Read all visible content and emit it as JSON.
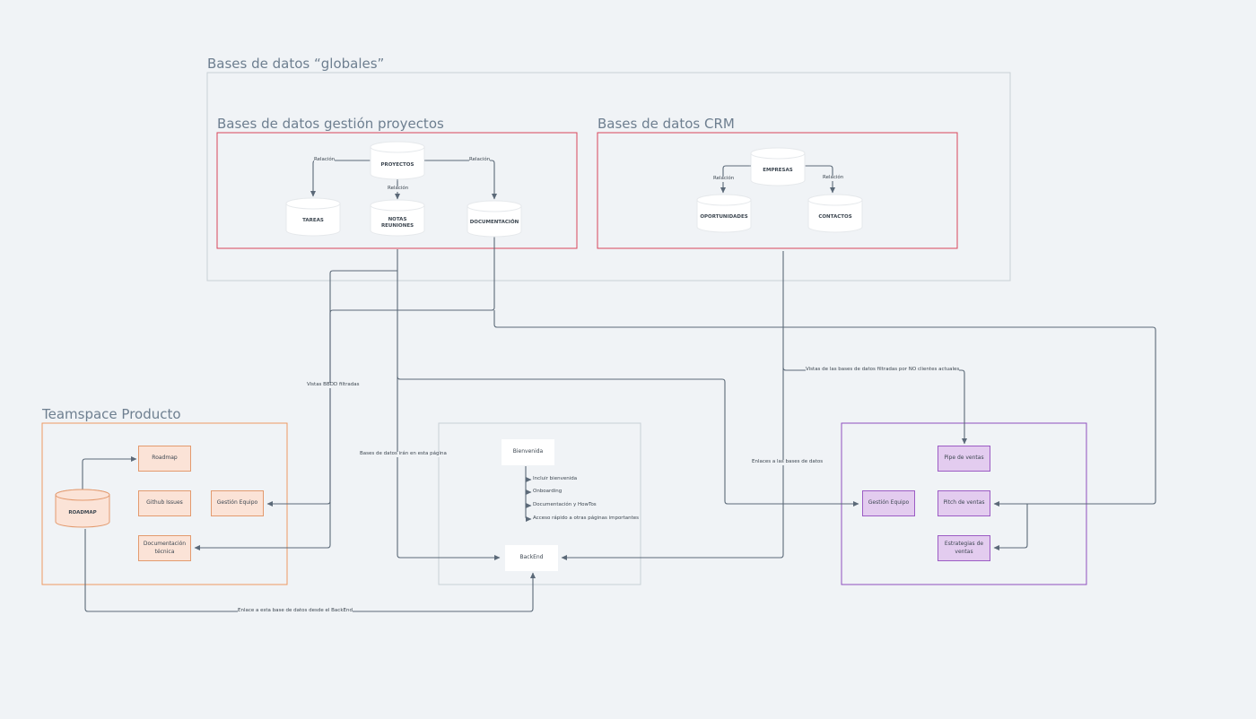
{
  "colors": {
    "background": "#f0f3f6",
    "connector": "#5b6978",
    "frame_global": "#c9d0d6",
    "frame_red": "#d9465a",
    "frame_orange": "#ee9a62",
    "frame_purple": "#8e4fbf",
    "frame_gray": "#c9d0d6"
  },
  "frames": {
    "global": {
      "title": "Bases de datos “globales”"
    },
    "projects": {
      "title": "Bases de datos gestión proyectos"
    },
    "crm": {
      "title": "Bases de datos CRM"
    },
    "producto": {
      "title": "Teamspace Producto"
    }
  },
  "databases": {
    "proyectos": "PROYECTOS",
    "tareas": "TAREAS",
    "notas": "NOTAS REUNIONES",
    "documentacion": "DOCUMENTACIÓN",
    "empresas": "EMPRESAS",
    "oportunidades": "OPORTUNIDADES",
    "contactos": "CONTACTOS",
    "roadmap": "ROADMAP"
  },
  "relations": {
    "proy_tareas": "Relación",
    "proy_notas": "Relación",
    "proy_doc": "Relación",
    "emp_oport": "Relación",
    "emp_contactos": "Relación"
  },
  "producto": {
    "roadmap": "Roadmap",
    "github": "Github Issues",
    "gestion": "Gestión Equipo",
    "doc_tecnica": "Documentación técnica"
  },
  "center": {
    "bienvenida": "Bienvenida",
    "items": [
      "Incluir bienvenida",
      "Onboarding",
      "Documentación y HowTos",
      "Acceso rápido a otras páginas importantes"
    ],
    "backend": "BackEnd"
  },
  "sales": {
    "gestion": "Gestión Equipo",
    "pipe": "Pipe de ventas",
    "pitch": "Pitch de ventas",
    "estrategias": "Estrategias de ventas"
  },
  "edge_labels": {
    "vistas_bbdd": "Vistas BBDD filtradas",
    "bases_iran": "Bases de datos irán en esta página",
    "vistas_no_clientes": "Vistas de las bases de datos filtradas por NO clientes actuales",
    "enlaces_bases": "Enlaces a las bases de datos",
    "enlace_roadmap": "Enlace a esta base de datos desde el BackEnd"
  }
}
